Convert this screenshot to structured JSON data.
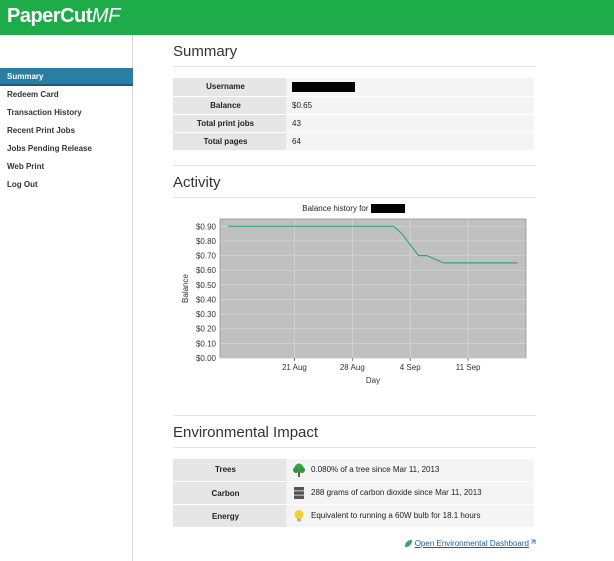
{
  "app": {
    "brand_main": "PaperCut",
    "brand_suffix": "MF"
  },
  "sidebar": {
    "items": [
      {
        "label": "Summary",
        "active": true
      },
      {
        "label": "Redeem Card"
      },
      {
        "label": "Transaction History"
      },
      {
        "label": "Recent Print Jobs"
      },
      {
        "label": "Jobs Pending Release"
      },
      {
        "label": "Web Print"
      },
      {
        "label": "Log Out"
      }
    ]
  },
  "summary": {
    "title": "Summary",
    "rows": [
      {
        "label": "Username",
        "value": ""
      },
      {
        "label": "Balance",
        "value": "$0.65"
      },
      {
        "label": "Total print jobs",
        "value": "43"
      },
      {
        "label": "Total pages",
        "value": "64"
      }
    ]
  },
  "activity": {
    "title": "Activity",
    "chart_title_prefix": "Balance history for"
  },
  "chart_data": {
    "type": "line",
    "title": "Balance history for",
    "xlabel": "Day",
    "ylabel": "Balance",
    "x_tick_labels": [
      "21 Aug",
      "28 Aug",
      "4 Sep",
      "11 Sep"
    ],
    "y_tick_labels": [
      "$0.00",
      "$0.10",
      "$0.20",
      "$0.30",
      "$0.40",
      "$0.50",
      "$0.60",
      "$0.70",
      "$0.80",
      "$0.90"
    ],
    "ylim": [
      0,
      0.95
    ],
    "grid": true,
    "series": [
      {
        "values": [
          {
            "x": "2013-08-13",
            "y": 0.9
          },
          {
            "x": "2013-09-02",
            "y": 0.9
          },
          {
            "x": "2013-09-03",
            "y": 0.85
          },
          {
            "x": "2013-09-05",
            "y": 0.7
          },
          {
            "x": "2013-09-06",
            "y": 0.7
          },
          {
            "x": "2013-09-08",
            "y": 0.65
          },
          {
            "x": "2013-09-17",
            "y": 0.65
          }
        ],
        "color": "#3aa66a"
      }
    ]
  },
  "environment": {
    "title": "Environmental Impact",
    "rows": [
      {
        "label": "Trees",
        "value": "0.080% of a tree since Mar 11, 2013",
        "icon": "tree-icon"
      },
      {
        "label": "Carbon",
        "value": "288 grams of carbon dioxide since Mar 11, 2013",
        "icon": "carbon-icon"
      },
      {
        "label": "Energy",
        "value": "Equivalent to running a 60W bulb for 18.1 hours",
        "icon": "bulb-icon"
      }
    ],
    "dashboard_link": "Open Environmental Dashboard"
  },
  "colors": {
    "brand_green": "#1eac4b",
    "nav_active": "#2a7ea1",
    "plot_bg": "#c0c0c0",
    "line": "#3aa66a"
  }
}
